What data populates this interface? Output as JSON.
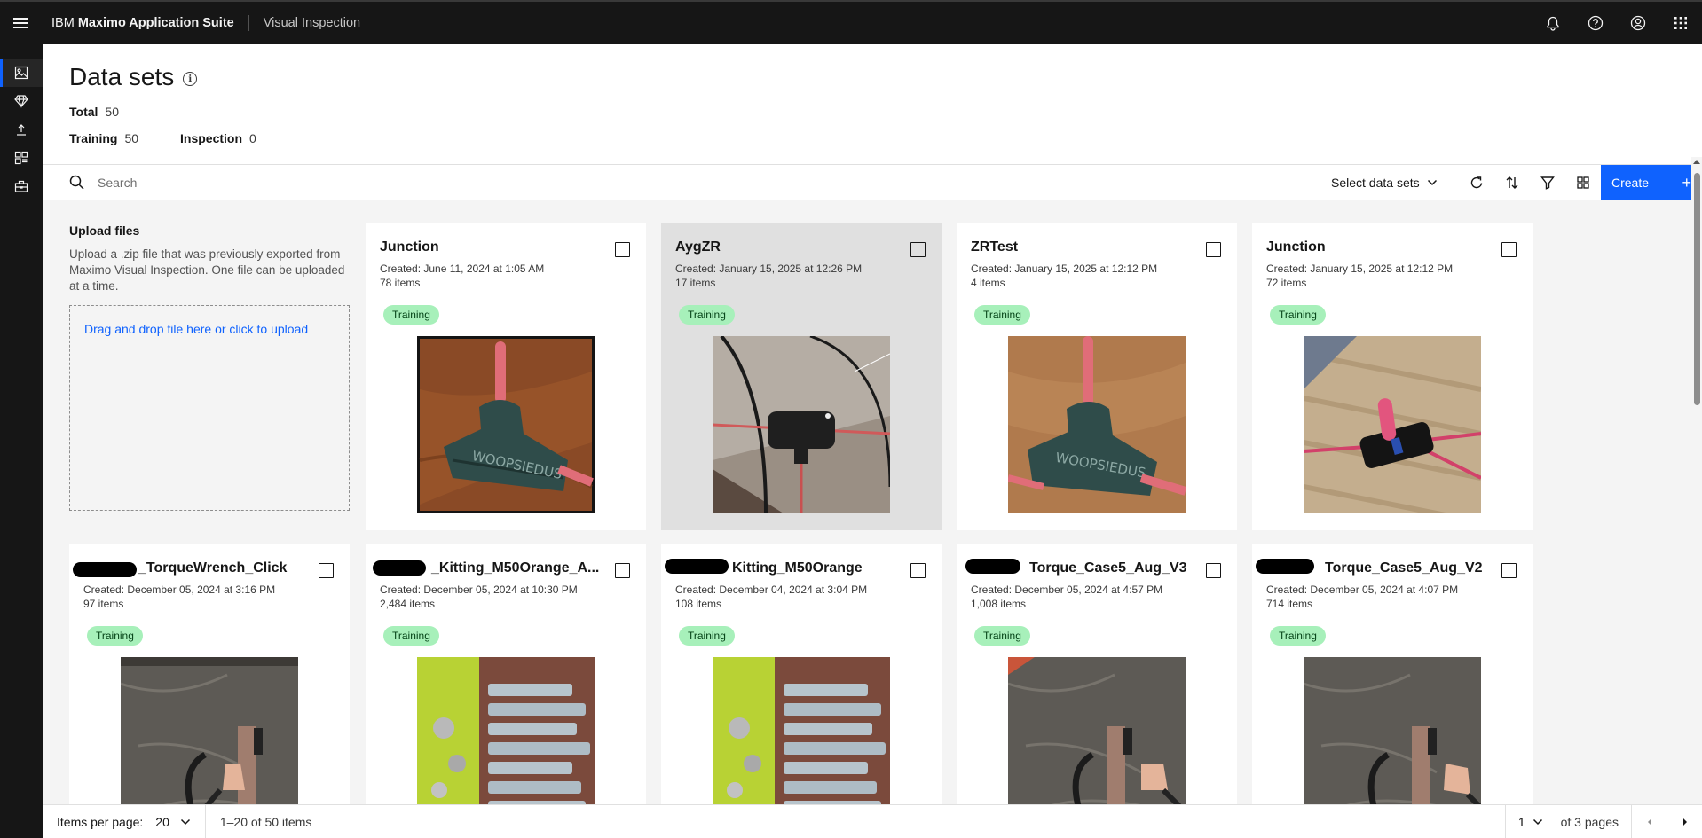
{
  "header": {
    "brand_prefix": "IBM",
    "brand_name": "Maximo Application Suite",
    "product": "Visual Inspection"
  },
  "page": {
    "title": "Data sets",
    "total_label": "Total",
    "total_value": "50",
    "training_label": "Training",
    "training_value": "50",
    "inspection_label": "Inspection",
    "inspection_value": "0"
  },
  "toolbar": {
    "search_placeholder": "Search",
    "select_label": "Select data sets",
    "create_label": "Create"
  },
  "upload": {
    "title": "Upload files",
    "description": "Upload a .zip file that was previously exported from Maximo Visual Inspection. One file can be uploaded at a time.",
    "dropzone_text": "Drag and drop file here or click to upload"
  },
  "cards": [
    {
      "title": "Junction",
      "created": "Created: June 11, 2024 at 1:05 AM",
      "count": "78 items",
      "tag": "Training"
    },
    {
      "title": "AygZR",
      "created": "Created: January 15, 2025 at 12:26 PM",
      "count": "17 items",
      "tag": "Training"
    },
    {
      "title": "ZRTest",
      "created": "Created: January 15, 2025 at 12:12 PM",
      "count": "4 items",
      "tag": "Training"
    },
    {
      "title": "Junction",
      "created": "Created: January 15, 2025 at 12:12 PM",
      "count": "72 items",
      "tag": "Training"
    },
    {
      "title": "_TorqueWrench_Click",
      "created": "Created: December 05, 2024 at 3:16 PM",
      "count": "97 items",
      "tag": "Training"
    },
    {
      "title": "_Kitting_M50Orange_A...",
      "created": "Created: December 05, 2024 at 10:30 PM",
      "count": "2,484 items",
      "tag": "Training"
    },
    {
      "title": "Kitting_M50Orange",
      "created": "Created: December 04, 2024 at 3:04 PM",
      "count": "108 items",
      "tag": "Training"
    },
    {
      "title": "Torque_Case5_Aug_V3",
      "created": "Created: December 05, 2024 at 4:57 PM",
      "count": "1,008 items",
      "tag": "Training"
    },
    {
      "title": "Torque_Case5_Aug_V2",
      "created": "Created: December 05, 2024 at 4:07 PM",
      "count": "714 items",
      "tag": "Training"
    }
  ],
  "footer": {
    "items_per_page_label": "Items per page:",
    "items_per_page_value": "20",
    "range_text": "1–20 of 50 items",
    "page_value": "1",
    "page_total_text": "of 3 pages"
  },
  "icons": {
    "menu": "hamburger-icon",
    "notification": "bell-icon",
    "help": "help-icon",
    "user": "user-avatar-icon",
    "apps": "app-switcher-icon"
  },
  "colors": {
    "accent": "#0f62fe",
    "header_bg": "#161616",
    "tag_bg": "#a7f0ba",
    "tag_text": "#044317"
  }
}
